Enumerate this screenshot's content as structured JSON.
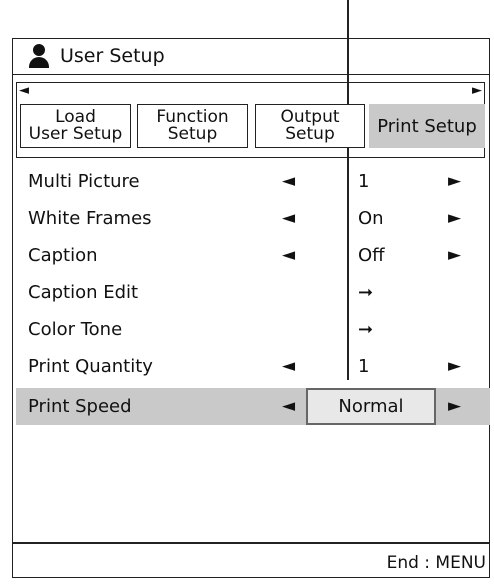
{
  "header": {
    "title": "User Setup",
    "icon": "user-icon"
  },
  "tabs": {
    "left_arrow": "◄",
    "right_arrow": "►",
    "items": [
      {
        "label": "Load\nUser Setup"
      },
      {
        "label": "Function\nSetup"
      },
      {
        "label": "Output\nSetup"
      },
      {
        "label": "Print Setup",
        "active": true
      }
    ]
  },
  "rows": [
    {
      "label": "Multi Picture",
      "left": "◄",
      "value": "1",
      "right": "►"
    },
    {
      "label": "White Frames",
      "left": "◄",
      "value": "On",
      "right": "►"
    },
    {
      "label": "Caption",
      "left": "◄",
      "value": "Off",
      "right": "►"
    },
    {
      "label": "Caption Edit",
      "left": "",
      "value": "➞",
      "right": ""
    },
    {
      "label": "Color Tone",
      "left": "",
      "value": "➞",
      "right": ""
    },
    {
      "label": "Print Quantity",
      "left": "◄",
      "value": "1",
      "right": "►"
    },
    {
      "label": "Print Speed",
      "left": "◄",
      "value": "Normal",
      "right": "►",
      "selected": true
    }
  ],
  "footer": {
    "text": "End : MENU"
  },
  "colors": {
    "selected_row": "#c9c9c9",
    "line": "#222222"
  }
}
